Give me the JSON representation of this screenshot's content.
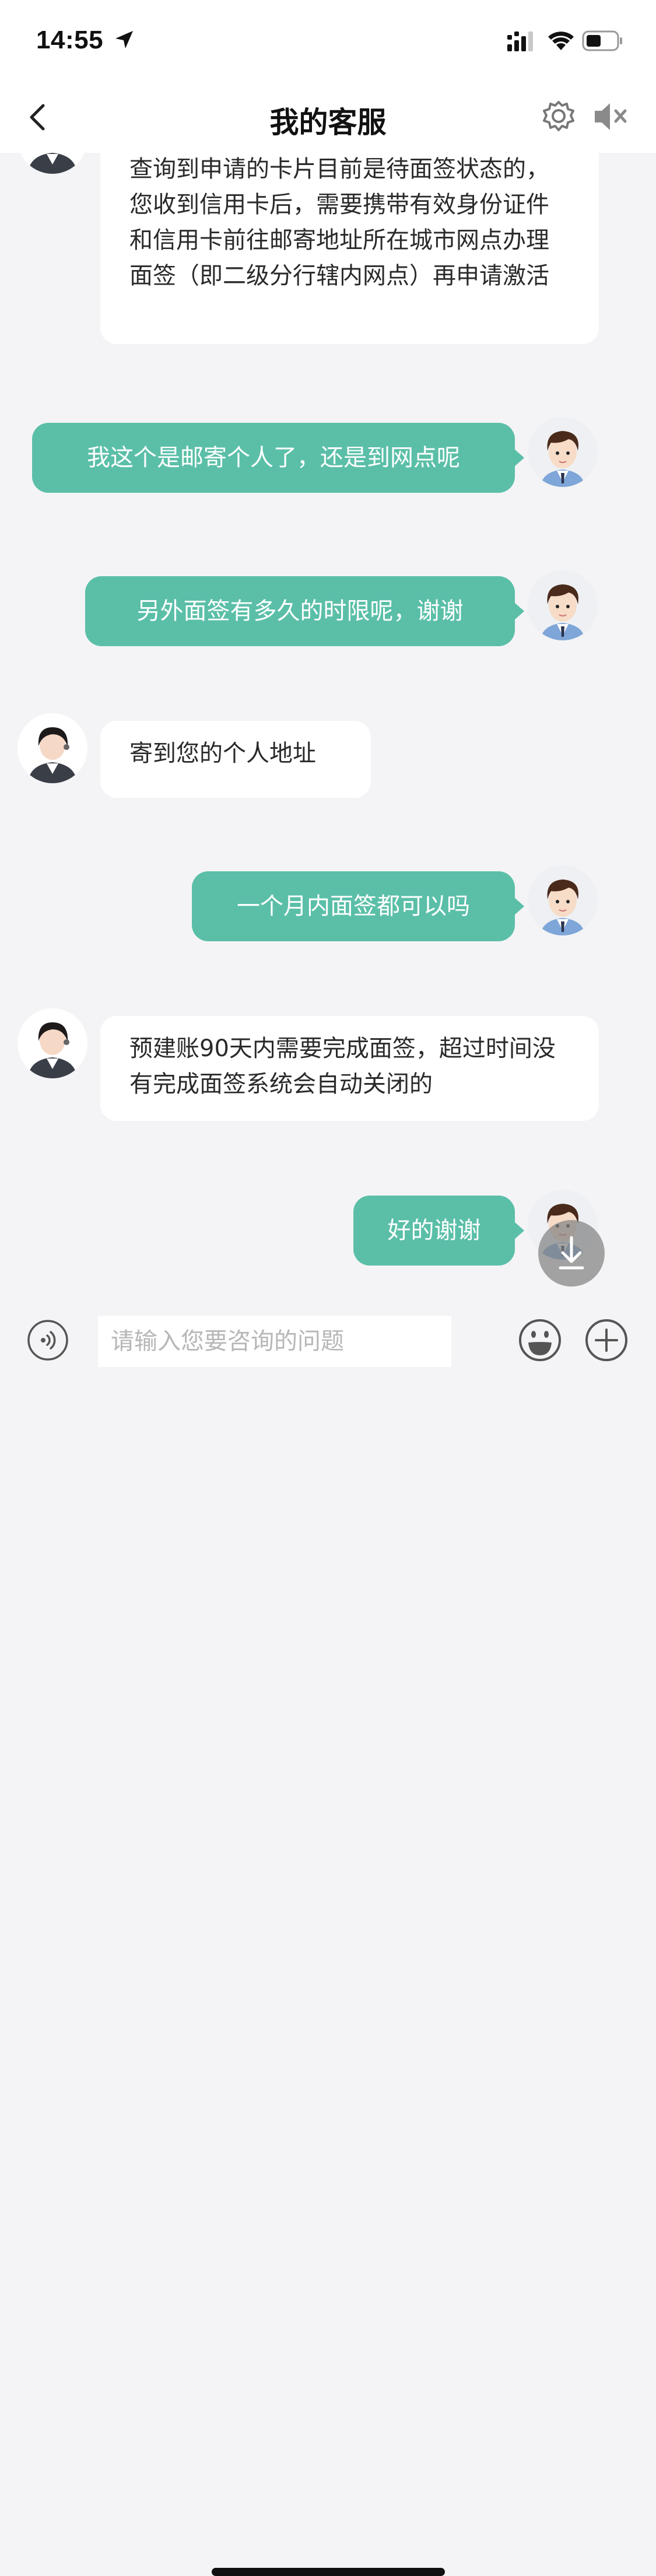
{
  "status_bar": {
    "time": "14:55"
  },
  "header": {
    "title": "我的客服"
  },
  "messages": [
    {
      "sender": "agent",
      "text": "查询到申请的卡片目前是待面签状态的，您收到信用卡后，需要携带有效身份证件和信用卡前往邮寄地址所在城市网点办理面签（即二级分行辖内网点）再申请激活"
    },
    {
      "sender": "user",
      "text": "我这个是邮寄个人了，还是到网点呢"
    },
    {
      "sender": "user",
      "text": "另外面签有多久的时限呢，谢谢"
    },
    {
      "sender": "agent",
      "text": "寄到您的个人地址"
    },
    {
      "sender": "user",
      "text": "一个月内面签都可以吗"
    },
    {
      "sender": "agent",
      "text": "预建账90天内需要完成面签，超过时间没有完成面签系统会自动关闭的"
    },
    {
      "sender": "user",
      "text": "好的谢谢"
    }
  ],
  "input": {
    "placeholder": "请输入您要咨询的问题",
    "value": ""
  },
  "colors": {
    "user_bubble": "#5bbfa8",
    "agent_bubble": "#ffffff",
    "background": "#f4f4f6"
  },
  "icons": {
    "back": "chevron-left-icon",
    "settings": "gear-icon",
    "sound": "speaker-muted-icon",
    "voice": "voice-icon",
    "emoji": "emoji-icon",
    "plus": "plus-icon",
    "scroll": "download-arrow-icon"
  }
}
